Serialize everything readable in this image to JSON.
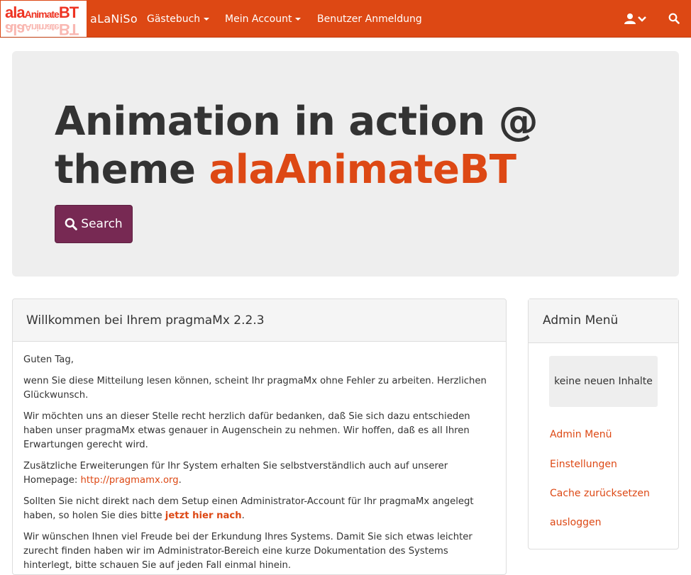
{
  "navbar": {
    "logo": {
      "text_main": "ala",
      "text_small": "Animate",
      "text_end": "BT"
    },
    "brand": "aLaNiSo",
    "items": [
      {
        "label": "Gästebuch"
      },
      {
        "label": "Mein Account"
      },
      {
        "label": "Benutzer Anmeldung"
      }
    ],
    "user_icon": "user-icon",
    "search_icon": "search-icon"
  },
  "jumbotron": {
    "title_part1": "Animation in action @ theme ",
    "title_accent": "alaAnimateBT",
    "search_label": "Search"
  },
  "main": {
    "heading": "Willkommen bei Ihrem pragmaMx 2.2.3",
    "greeting": "Guten Tag,",
    "p1": "wenn Sie diese Mitteilung lesen können, scheint Ihr pragmaMx ohne Fehler zu arbeiten. Herzlichen Glückwunsch.",
    "p2": "Wir möchten uns an dieser Stelle recht herzlich dafür bedanken, daß Sie sich dazu entschieden haben unser pragmaMx etwas genauer in Augenschein zu nehmen. Wir hoffen, daß es all Ihren Erwartungen gerecht wird.",
    "p3_text": "Zusätzliche Erweiterungen für Ihr System erhalten Sie selbstverständlich auch auf unserer Homepage: ",
    "p3_link": "http://pragmamx.org",
    "p3_end": ".",
    "p4_text": "Sollten Sie nicht direkt nach dem Setup einen Administrator-Account für Ihr pragmaMx angelegt haben, so holen Sie dies bitte ",
    "p4_link": "jetzt hier nach",
    "p4_end": ".",
    "p5": "Wir wünschen Ihnen viel Freude bei der Erkundung Ihres Systems. Damit Sie sich etwas leichter zurecht finden haben wir im Administrator-Bereich eine kurze Dokumentation des Systems hinterlegt, bitte schauen Sie auf jeden Fall einmal hinein."
  },
  "sidebar": {
    "heading": "Admin Menü",
    "note": "keine neuen Inhalte",
    "links": [
      {
        "label": "Admin Menü"
      },
      {
        "label": "Einstellungen"
      },
      {
        "label": "Cache zurücksetzen"
      },
      {
        "label": "ausloggen"
      }
    ]
  },
  "colors": {
    "primary": "#dd4814",
    "button": "#772953",
    "jumbotron_bg": "#eeeeee"
  }
}
